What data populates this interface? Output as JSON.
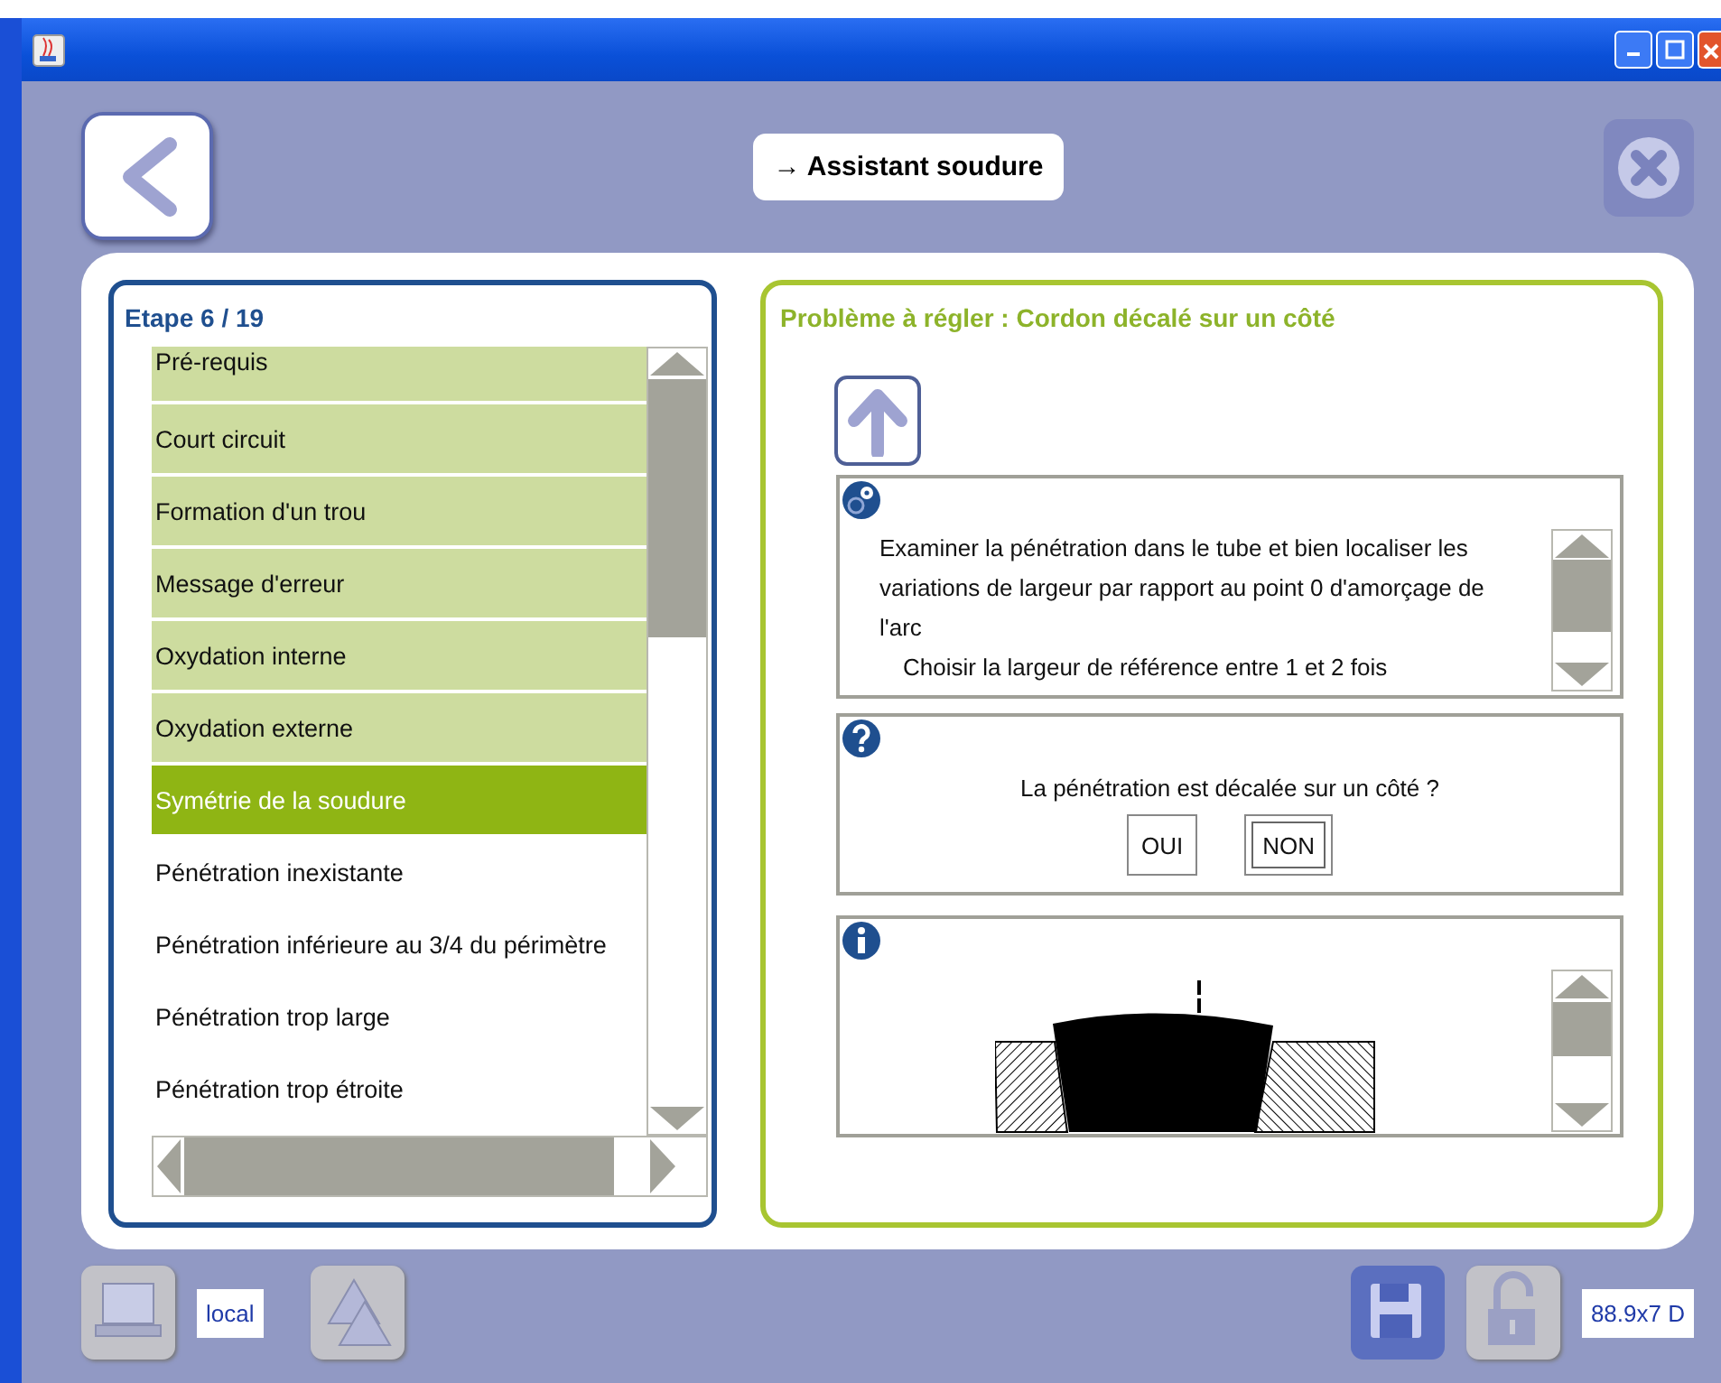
{
  "header": {
    "title": "→ Assistant soudure"
  },
  "steps": {
    "label": "Etape 6 / 19",
    "items": [
      {
        "label": "Pré-requis",
        "done": true,
        "selected": false
      },
      {
        "label": "Court circuit",
        "done": true,
        "selected": false
      },
      {
        "label": "Formation d'un trou",
        "done": true,
        "selected": false
      },
      {
        "label": "Message d'erreur",
        "done": true,
        "selected": false
      },
      {
        "label": "Oxydation interne",
        "done": true,
        "selected": false
      },
      {
        "label": "Oxydation externe",
        "done": true,
        "selected": false
      },
      {
        "label": "Symétrie de la soudure",
        "done": false,
        "selected": true
      },
      {
        "label": "Pénétration inexistante",
        "done": false,
        "selected": false
      },
      {
        "label": "Pénétration inférieure au 3/4 du périmètre",
        "done": false,
        "selected": false
      },
      {
        "label": "Pénétration trop large",
        "done": false,
        "selected": false
      },
      {
        "label": "Pénétration trop étroite",
        "done": false,
        "selected": false
      }
    ]
  },
  "problem": {
    "title": "Problème à régler : Cordon décalé sur un côté",
    "instruction": "Examiner la pénétration dans le tube et bien localiser les variations de largeur par rapport au point 0 d'amorçage de l'arc",
    "note": "Choisir la largeur de référence entre 1 et 2 fois",
    "question": "La pénétration est décalée sur un côté ?",
    "answers": [
      {
        "label": "OUI",
        "focused": false
      },
      {
        "label": "NON",
        "focused": true
      }
    ]
  },
  "footer": {
    "left_tools": [
      {
        "kind": "computer",
        "disabled": true
      },
      {
        "kind": "triangles",
        "disabled": true
      }
    ],
    "location": "local",
    "right_tools": [
      {
        "kind": "save",
        "disabled": false
      },
      {
        "kind": "lock",
        "disabled": true
      }
    ],
    "dimensions": "88.9x7 D"
  }
}
